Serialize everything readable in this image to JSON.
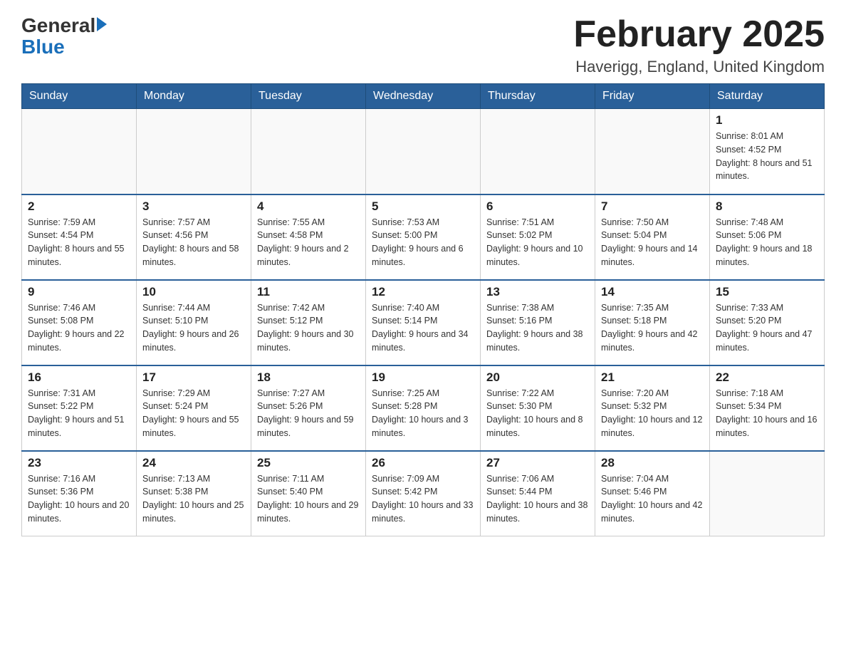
{
  "header": {
    "logo_general": "General",
    "logo_blue": "Blue",
    "month_title": "February 2025",
    "location": "Haverigg, England, United Kingdom"
  },
  "days_of_week": [
    "Sunday",
    "Monday",
    "Tuesday",
    "Wednesday",
    "Thursday",
    "Friday",
    "Saturday"
  ],
  "weeks": [
    [
      {
        "day": "",
        "info": ""
      },
      {
        "day": "",
        "info": ""
      },
      {
        "day": "",
        "info": ""
      },
      {
        "day": "",
        "info": ""
      },
      {
        "day": "",
        "info": ""
      },
      {
        "day": "",
        "info": ""
      },
      {
        "day": "1",
        "info": "Sunrise: 8:01 AM\nSunset: 4:52 PM\nDaylight: 8 hours and 51 minutes."
      }
    ],
    [
      {
        "day": "2",
        "info": "Sunrise: 7:59 AM\nSunset: 4:54 PM\nDaylight: 8 hours and 55 minutes."
      },
      {
        "day": "3",
        "info": "Sunrise: 7:57 AM\nSunset: 4:56 PM\nDaylight: 8 hours and 58 minutes."
      },
      {
        "day": "4",
        "info": "Sunrise: 7:55 AM\nSunset: 4:58 PM\nDaylight: 9 hours and 2 minutes."
      },
      {
        "day": "5",
        "info": "Sunrise: 7:53 AM\nSunset: 5:00 PM\nDaylight: 9 hours and 6 minutes."
      },
      {
        "day": "6",
        "info": "Sunrise: 7:51 AM\nSunset: 5:02 PM\nDaylight: 9 hours and 10 minutes."
      },
      {
        "day": "7",
        "info": "Sunrise: 7:50 AM\nSunset: 5:04 PM\nDaylight: 9 hours and 14 minutes."
      },
      {
        "day": "8",
        "info": "Sunrise: 7:48 AM\nSunset: 5:06 PM\nDaylight: 9 hours and 18 minutes."
      }
    ],
    [
      {
        "day": "9",
        "info": "Sunrise: 7:46 AM\nSunset: 5:08 PM\nDaylight: 9 hours and 22 minutes."
      },
      {
        "day": "10",
        "info": "Sunrise: 7:44 AM\nSunset: 5:10 PM\nDaylight: 9 hours and 26 minutes."
      },
      {
        "day": "11",
        "info": "Sunrise: 7:42 AM\nSunset: 5:12 PM\nDaylight: 9 hours and 30 minutes."
      },
      {
        "day": "12",
        "info": "Sunrise: 7:40 AM\nSunset: 5:14 PM\nDaylight: 9 hours and 34 minutes."
      },
      {
        "day": "13",
        "info": "Sunrise: 7:38 AM\nSunset: 5:16 PM\nDaylight: 9 hours and 38 minutes."
      },
      {
        "day": "14",
        "info": "Sunrise: 7:35 AM\nSunset: 5:18 PM\nDaylight: 9 hours and 42 minutes."
      },
      {
        "day": "15",
        "info": "Sunrise: 7:33 AM\nSunset: 5:20 PM\nDaylight: 9 hours and 47 minutes."
      }
    ],
    [
      {
        "day": "16",
        "info": "Sunrise: 7:31 AM\nSunset: 5:22 PM\nDaylight: 9 hours and 51 minutes."
      },
      {
        "day": "17",
        "info": "Sunrise: 7:29 AM\nSunset: 5:24 PM\nDaylight: 9 hours and 55 minutes."
      },
      {
        "day": "18",
        "info": "Sunrise: 7:27 AM\nSunset: 5:26 PM\nDaylight: 9 hours and 59 minutes."
      },
      {
        "day": "19",
        "info": "Sunrise: 7:25 AM\nSunset: 5:28 PM\nDaylight: 10 hours and 3 minutes."
      },
      {
        "day": "20",
        "info": "Sunrise: 7:22 AM\nSunset: 5:30 PM\nDaylight: 10 hours and 8 minutes."
      },
      {
        "day": "21",
        "info": "Sunrise: 7:20 AM\nSunset: 5:32 PM\nDaylight: 10 hours and 12 minutes."
      },
      {
        "day": "22",
        "info": "Sunrise: 7:18 AM\nSunset: 5:34 PM\nDaylight: 10 hours and 16 minutes."
      }
    ],
    [
      {
        "day": "23",
        "info": "Sunrise: 7:16 AM\nSunset: 5:36 PM\nDaylight: 10 hours and 20 minutes."
      },
      {
        "day": "24",
        "info": "Sunrise: 7:13 AM\nSunset: 5:38 PM\nDaylight: 10 hours and 25 minutes."
      },
      {
        "day": "25",
        "info": "Sunrise: 7:11 AM\nSunset: 5:40 PM\nDaylight: 10 hours and 29 minutes."
      },
      {
        "day": "26",
        "info": "Sunrise: 7:09 AM\nSunset: 5:42 PM\nDaylight: 10 hours and 33 minutes."
      },
      {
        "day": "27",
        "info": "Sunrise: 7:06 AM\nSunset: 5:44 PM\nDaylight: 10 hours and 38 minutes."
      },
      {
        "day": "28",
        "info": "Sunrise: 7:04 AM\nSunset: 5:46 PM\nDaylight: 10 hours and 42 minutes."
      },
      {
        "day": "",
        "info": ""
      }
    ]
  ]
}
